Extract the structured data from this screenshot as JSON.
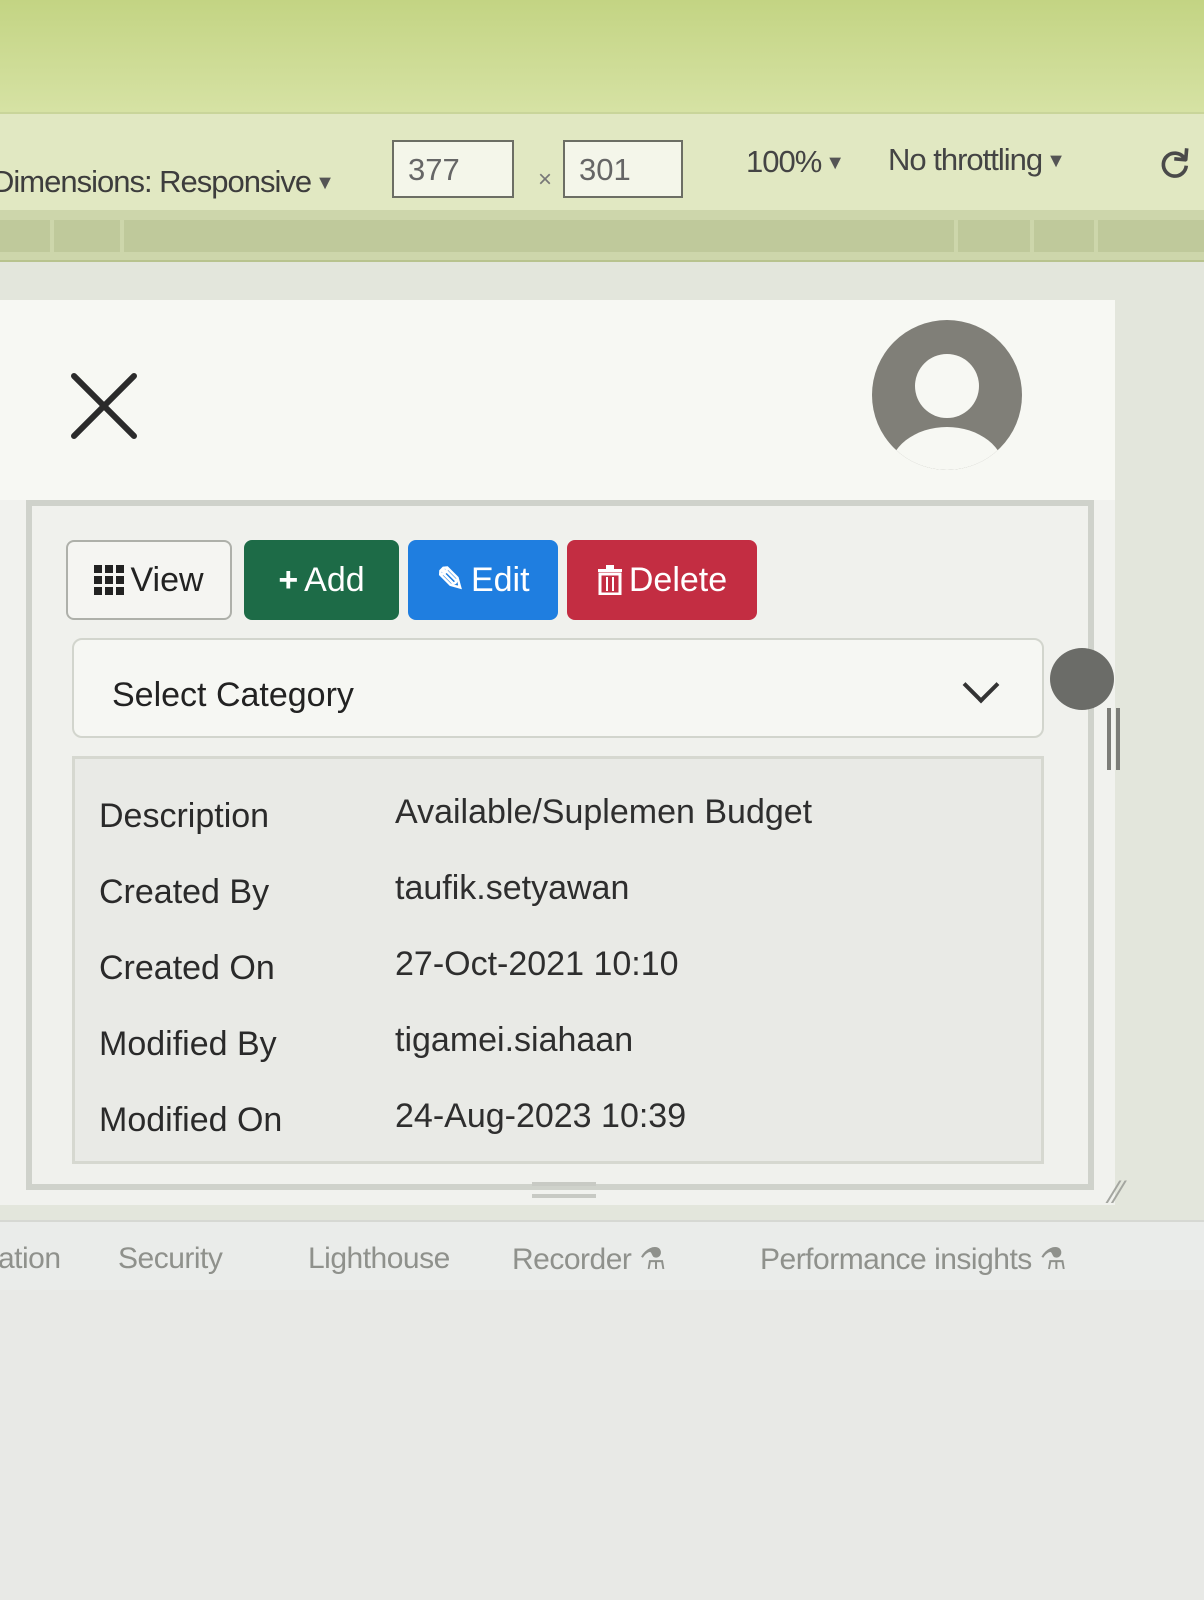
{
  "device_toolbar": {
    "dimensions_label": "Dimensions: Responsive",
    "width_value": "377",
    "times_sign": "×",
    "height_value": "301",
    "zoom": "100%",
    "throttling": "No throttling"
  },
  "toolbar": {
    "view_label": "View",
    "add_label": "Add",
    "edit_label": "Edit",
    "delete_label": "Delete",
    "colors": {
      "add": "#1d6b47",
      "edit": "#1f7ee0",
      "delete": "#c32d42"
    }
  },
  "category_select": {
    "selected": "Select Category"
  },
  "details": [
    {
      "key": "Description",
      "value": "Available/Suplemen Budget"
    },
    {
      "key": "Created By",
      "value": "taufik.setyawan"
    },
    {
      "key": "Created On",
      "value": "27-Oct-2021 10:10"
    },
    {
      "key": "Modified By",
      "value": "tigamei.siahaan"
    },
    {
      "key": "Modified On",
      "value": "24-Aug-2023 10:39"
    }
  ],
  "devtools_tabs": [
    {
      "label": "ation"
    },
    {
      "label": "Security"
    },
    {
      "label": "Lighthouse"
    },
    {
      "label": "Recorder ⚗"
    },
    {
      "label": "Performance insights ⚗"
    }
  ],
  "icons": {
    "close": "close-icon",
    "avatar": "user-avatar-icon",
    "view": "grid-icon",
    "add": "plus-icon",
    "edit": "pencil-icon",
    "delete": "trash-icon",
    "select": "chevron-down-icon",
    "rotate": "rotate-icon"
  }
}
